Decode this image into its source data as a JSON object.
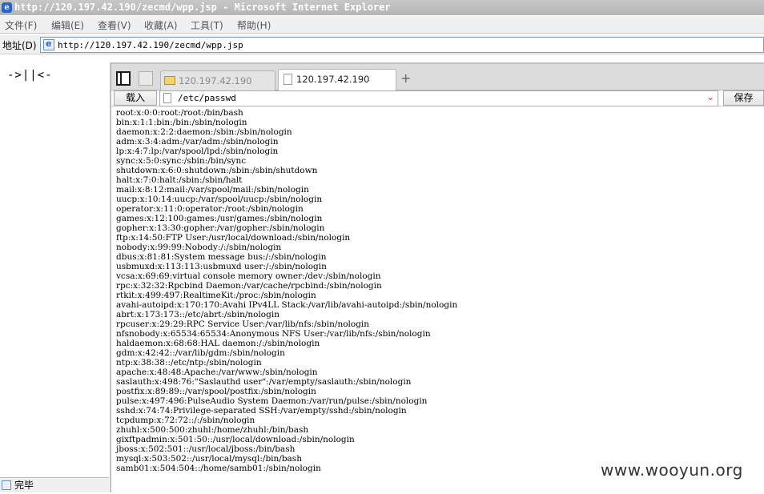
{
  "window": {
    "title": "http://120.197.42.190/zecmd/wpp.jsp - Microsoft Internet Explorer"
  },
  "menu": {
    "items": [
      "文件(F)",
      "编辑(E)",
      "查看(V)",
      "收藏(A)",
      "工具(T)",
      "帮助(H)"
    ]
  },
  "address": {
    "label": "地址(D)",
    "url": "http://120.197.42.190/zecmd/wpp.jsp"
  },
  "left_pane": {
    "logo": "->||<-"
  },
  "tabs": [
    {
      "label": "120.197.42.190"
    },
    {
      "label": "120.197.42.190"
    }
  ],
  "toolbar": {
    "load_label": "载入",
    "path": "/etc/passwd",
    "save_label": "保存",
    "add_tab": "+"
  },
  "file_lines": [
    "root:x:0:0:root:/root:/bin/bash",
    "bin:x:1:1:bin:/bin:/sbin/nologin",
    "daemon:x:2:2:daemon:/sbin:/sbin/nologin",
    "adm:x:3:4:adm:/var/adm:/sbin/nologin",
    "lp:x:4:7:lp:/var/spool/lpd:/sbin/nologin",
    "sync:x:5:0:sync:/sbin:/bin/sync",
    "shutdown:x:6:0:shutdown:/sbin:/sbin/shutdown",
    "halt:x:7:0:halt:/sbin:/sbin/halt",
    "mail:x:8:12:mail:/var/spool/mail:/sbin/nologin",
    "uucp:x:10:14:uucp:/var/spool/uucp:/sbin/nologin",
    "operator:x:11:0:operator:/root:/sbin/nologin",
    "games:x:12:100:games:/usr/games:/sbin/nologin",
    "gopher:x:13:30:gopher:/var/gopher:/sbin/nologin",
    "ftp:x:14:50:FTP User:/usr/local/download:/sbin/nologin",
    "nobody:x:99:99:Nobody:/:/sbin/nologin",
    "dbus:x:81:81:System message bus:/:/sbin/nologin",
    "usbmuxd:x:113:113:usbmuxd user:/:/sbin/nologin",
    "vcsa:x:69:69:virtual console memory owner:/dev:/sbin/nologin",
    "rpc:x:32:32:Rpcbind Daemon:/var/cache/rpcbind:/sbin/nologin",
    "rtkit:x:499:497:RealtimeKit:/proc:/sbin/nologin",
    "avahi-autoipd:x:170:170:Avahi IPv4LL Stack:/var/lib/avahi-autoipd:/sbin/nologin",
    "abrt:x:173:173::/etc/abrt:/sbin/nologin",
    "rpcuser:x:29:29:RPC Service User:/var/lib/nfs:/sbin/nologin",
    "nfsnobody:x:65534:65534:Anonymous NFS User:/var/lib/nfs:/sbin/nologin",
    "haldaemon:x:68:68:HAL daemon:/:/sbin/nologin",
    "gdm:x:42:42::/var/lib/gdm:/sbin/nologin",
    "ntp:x:38:38::/etc/ntp:/sbin/nologin",
    "apache:x:48:48:Apache:/var/www:/sbin/nologin",
    "saslauth:x:498:76:\"Saslauthd user\":/var/empty/saslauth:/sbin/nologin",
    "postfix:x:89:89::/var/spool/postfix:/sbin/nologin",
    "pulse:x:497:496:PulseAudio System Daemon:/var/run/pulse:/sbin/nologin",
    "sshd:x:74:74:Privilege-separated SSH:/var/empty/sshd:/sbin/nologin",
    "tcpdump:x:72:72::/:/sbin/nologin",
    "zhuhl:x:500:500:zhuhl:/home/zhuhl:/bin/bash",
    "gixftpadmin:x:501:50::/usr/local/download:/sbin/nologin",
    "jboss:x:502:501::/usr/local/jboss:/bin/bash",
    "mysql:x:503:502::/usr/local/mysql:/bin/bash",
    "samb01:x:504:504::/home/samb01:/sbin/nologin"
  ],
  "status": {
    "text": "完毕"
  },
  "watermark": {
    "text": "www.wooyun.org"
  }
}
